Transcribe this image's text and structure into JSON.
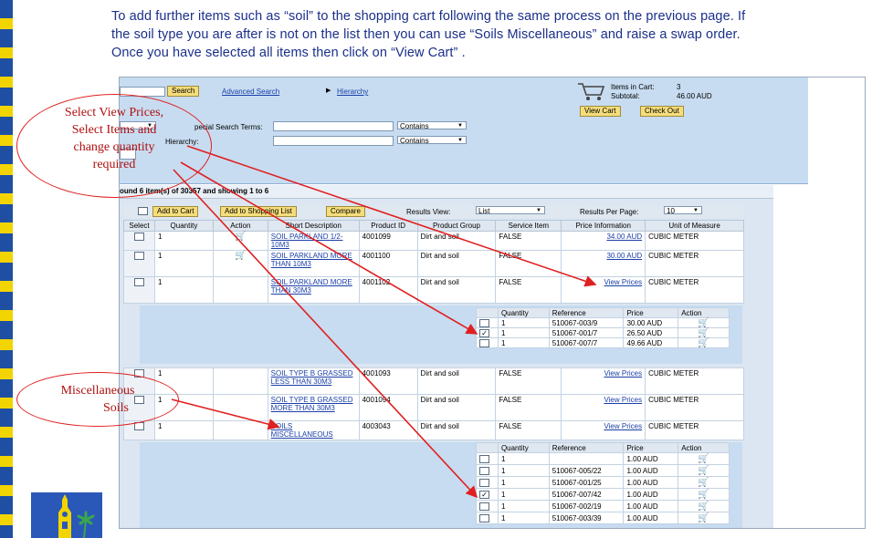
{
  "instructions": {
    "line1": "To add further items such as “soil” to the shopping cart following the same process on the previous page. If",
    "line2": "the soil type you are after is not on the list then you can use “Soils Miscellaneous” and raise a swap order.",
    "line3": "Once you have selected all items then click on “View Cart” ."
  },
  "callouts": {
    "first": {
      "line1": "Select View Prices,",
      "line2": "Select Items  and",
      "line3": "change quantity",
      "line4": "required"
    },
    "second": {
      "line1": "Miscellaneous",
      "line2": "Soils"
    }
  },
  "toolbar": {
    "search_button": "Search",
    "advanced_search": "Advanced Search",
    "hierarchy": "Hierarchy"
  },
  "cart_summary": {
    "items_label": "Items in Cart:",
    "items_value": "3",
    "subtotal_label": "Subtotal:",
    "subtotal_value": "46.00 AUD",
    "view_cart": "View Cart",
    "check_out": "Check Out"
  },
  "search_form": {
    "special_terms_label": "pecial Search Terms:",
    "hierarchy_label": "Hierarchy:",
    "contains_1": "Contains",
    "contains_2": "Contains"
  },
  "results": {
    "summary": "ound 6 item(s) of 30357 and showing 1 to 6",
    "add_to_cart": "Add to Cart",
    "add_to_shopping_list": "Add to Shopping List",
    "compare": "Compare",
    "results_view_label": "Results View:",
    "results_view_value": "List",
    "per_page_label": "Results Per Page:",
    "per_page_value": "10",
    "columns": [
      "Select",
      "Quantity",
      "Action",
      "Short Description",
      "Product ID",
      "Product Group",
      "Service Item",
      "Price Information",
      "Unit of Measure"
    ],
    "rows": [
      {
        "qty": "1",
        "desc": "SOIL PARKLAND 1/2-10M3",
        "id": "4001099",
        "group": "Dirt and soil",
        "service": "FALSE",
        "price": "34.00 AUD",
        "uom": "CUBIC METER"
      },
      {
        "qty": "1",
        "desc": "SOIL PARKLAND MORE THAN 10M3",
        "id": "4001100",
        "group": "Dirt and soil",
        "service": "FALSE",
        "price": "30.00 AUD",
        "uom": "CUBIC METER"
      },
      {
        "qty": "1",
        "desc": "SOIL PARKLAND MORE THAN 30M3",
        "id": "4001102",
        "group": "Dirt and soil",
        "service": "FALSE",
        "price": "View Prices",
        "uom": "CUBIC METER"
      },
      {
        "qty": "1",
        "desc": "SOIL TYPE B GRASSED LESS THAN 30M3",
        "id": "4001093",
        "group": "Dirt and soil",
        "service": "FALSE",
        "price": "View Prices",
        "uom": "CUBIC METER"
      },
      {
        "qty": "1",
        "desc": "SOIL TYPE B GRASSED MORE THAN 30M3",
        "id": "4001094",
        "group": "Dirt and soil",
        "service": "FALSE",
        "price": "View Prices",
        "uom": "CUBIC METER"
      },
      {
        "qty": "1",
        "desc": "SOILS MISCELLANEOUS",
        "id": "4003043",
        "group": "Dirt and soil",
        "service": "FALSE",
        "price": "View Prices",
        "uom": "CUBIC METER"
      }
    ],
    "sub1": {
      "columns": [
        "Quantity",
        "Reference",
        "Price",
        "Action"
      ],
      "rows": [
        {
          "checked": false,
          "qty": "1",
          "ref": "510067-003/9",
          "price": "30.00 AUD"
        },
        {
          "checked": true,
          "qty": "1",
          "ref": "510067-001/7",
          "price": "26.50 AUD"
        },
        {
          "checked": false,
          "qty": "1",
          "ref": "510067-007/7",
          "price": "49.66 AUD"
        }
      ]
    },
    "sub2": {
      "columns": [
        "Quantity",
        "Reference",
        "Price",
        "Action"
      ],
      "rows": [
        {
          "checked": false,
          "qty": "1",
          "ref": "",
          "price": "1.00 AUD"
        },
        {
          "checked": false,
          "qty": "1",
          "ref": "510067-005/22",
          "price": "1.00 AUD"
        },
        {
          "checked": false,
          "qty": "1",
          "ref": "510067-001/25",
          "price": "1.00 AUD"
        },
        {
          "checked": true,
          "qty": "1",
          "ref": "510067-007/42",
          "price": "1.00 AUD"
        },
        {
          "checked": false,
          "qty": "1",
          "ref": "510067-002/19",
          "price": "1.00 AUD"
        },
        {
          "checked": false,
          "qty": "1",
          "ref": "510067-003/39",
          "price": "1.00 AUD"
        }
      ]
    }
  },
  "icons": {
    "cart": "shopping-cart-icon",
    "expand": "play-triangle-icon"
  },
  "colors": {
    "instruction_text": "#1a2f8a",
    "panel_bg": "#c7dcf1",
    "button_bg": "#f5dd7a",
    "callout_red": "#e02020"
  }
}
